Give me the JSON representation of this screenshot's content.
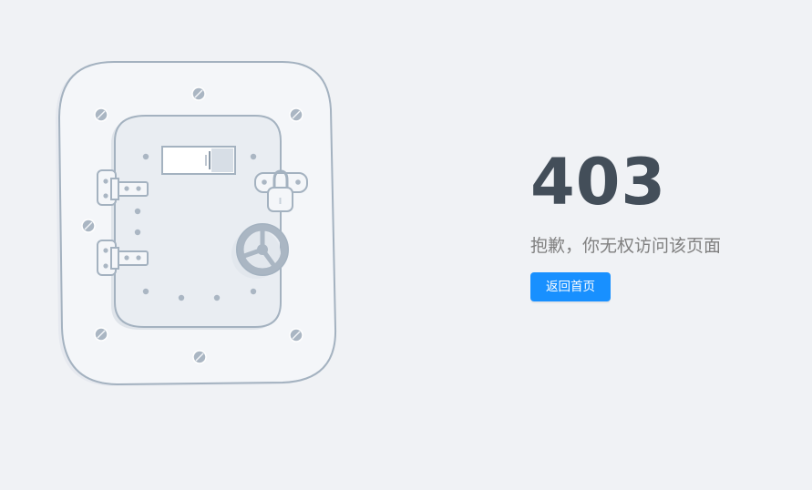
{
  "error": {
    "code": "403",
    "description": "抱歉，你无权访问该页面",
    "back_button_label": "返回首页"
  },
  "icons": {
    "illustration": "locked-safe-door-icon"
  },
  "colors": {
    "background": "#f0f2f5",
    "title": "#434e59",
    "description": "#808080",
    "primary_button": "#1890ff",
    "illustration_stroke": "#a4b2c0",
    "illustration_fill": "#e9edf2"
  }
}
